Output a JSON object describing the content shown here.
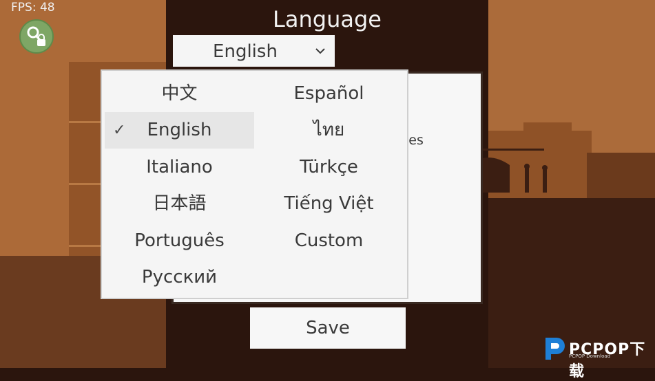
{
  "hud": {
    "fps_label": "FPS: 48"
  },
  "dialog": {
    "title": "Language",
    "selected_value": "English",
    "panel_peek_text": "ies",
    "save_label": "Save"
  },
  "languages": {
    "left": [
      "中文",
      "English",
      "Italiano",
      "日本語",
      "Português",
      "Русский"
    ],
    "right": [
      "Español",
      "ไทย",
      "Türkçe",
      "Tiếng Việt",
      "Custom"
    ],
    "selected": "English",
    "check_mark": "✓"
  },
  "watermark": {
    "text": "PCPOP下载",
    "sub": "PCPOP Download"
  },
  "icons": {
    "key": "key-lock-icon",
    "chevron": "chevron-down-icon"
  },
  "colors": {
    "accent": "#7ea665",
    "panel": "#f5f5f5",
    "scene_dark": "#2b150d"
  }
}
